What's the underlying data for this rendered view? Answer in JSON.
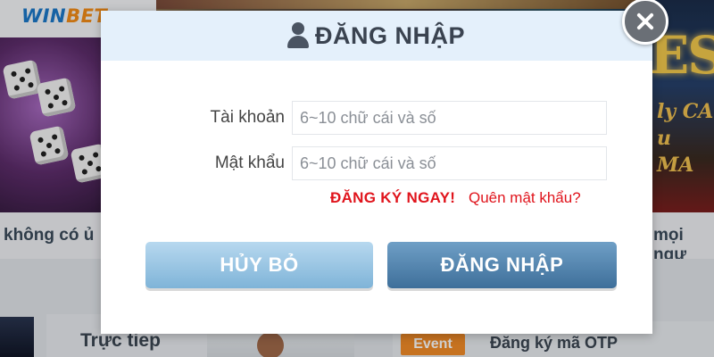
{
  "brand": {
    "logo_prefix": "WIN",
    "logo_suffix": "BET"
  },
  "background": {
    "banner_right_title": "ES",
    "banner_right_sub_1": "ly CA",
    "banner_right_sub_2": "u MA",
    "marquee_left": "không có ủ",
    "marquee_right": "mọi ngư",
    "live_label": "Trực tiep",
    "event_badge": "Event",
    "event_text": "Đăng ký mã OTP"
  },
  "modal": {
    "title": "ĐĂNG NHẬP",
    "username_label": "Tài khoản",
    "username_placeholder": "6~10 chữ cái và số",
    "username_value": "",
    "password_label": "Mật khẩu",
    "password_placeholder": "6~10 chữ cái và số",
    "password_value": "",
    "register_link": "ĐĂNG KÝ NGAY!",
    "forgot_link": "Quên mật khẩu?",
    "cancel_button": "HỦY BỎ",
    "login_button": "ĐĂNG NHẬP",
    "close_icon": "close-icon"
  },
  "colors": {
    "accent_red": "#e0141c",
    "primary_button": "#3e6f9a",
    "secondary_button": "#7fb4d8",
    "logo_orange": "#f28c18",
    "header_bg": "#e4f0fb"
  }
}
